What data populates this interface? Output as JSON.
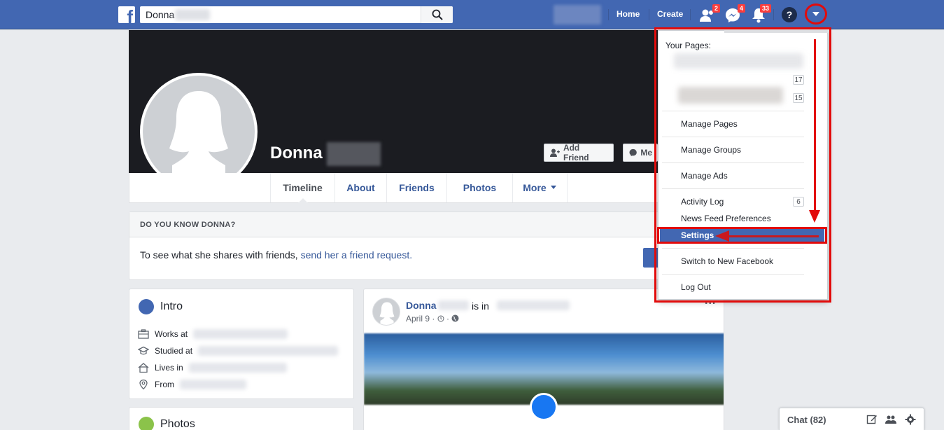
{
  "topbar": {
    "logo_letter": "f",
    "search_value": "Donna",
    "home_label": "Home",
    "create_label": "Create",
    "friend_requests_badge": "2",
    "messages_badge": "4",
    "notifications_badge": "33",
    "help_label": "?",
    "accent_color": "#4267b2"
  },
  "profile": {
    "name": "Donna",
    "add_friend_label": "Add Friend",
    "message_label": "Me",
    "tabs": [
      {
        "label": "Timeline"
      },
      {
        "label": "About"
      },
      {
        "label": "Friends"
      },
      {
        "label": "Photos"
      },
      {
        "label": "More"
      }
    ]
  },
  "know_card": {
    "heading": "DO YOU KNOW DONNA?",
    "text": "To see what she shares with friends, ",
    "link": "send her a friend request."
  },
  "intro": {
    "title": "Intro",
    "rows": [
      {
        "label": "Works at",
        "icon": "briefcase-icon"
      },
      {
        "label": "Studied at",
        "icon": "graduation-cap-icon"
      },
      {
        "label": "Lives in",
        "icon": "home-icon"
      },
      {
        "label": "From",
        "icon": "location-pin-icon"
      }
    ]
  },
  "photos_card": {
    "title": "Photos"
  },
  "post": {
    "author": "Donna",
    "is_in": "is in",
    "date": "April 9 · ",
    "more_label": "..."
  },
  "dropdown": {
    "your_pages_label": "Your Pages:",
    "page_counts": [
      "17",
      "15"
    ],
    "items": [
      {
        "label": "Manage Pages"
      },
      {
        "label": "Manage Groups"
      },
      {
        "label": "Manage Ads"
      },
      {
        "label": "Activity Log",
        "count": "6"
      },
      {
        "label": "News Feed Preferences"
      },
      {
        "label": "Settings",
        "highlighted": true
      },
      {
        "label": "Switch to New Facebook"
      },
      {
        "label": "Log Out"
      }
    ],
    "annotation_color": "#e20b0b"
  },
  "chat": {
    "label": "Chat (82)"
  }
}
